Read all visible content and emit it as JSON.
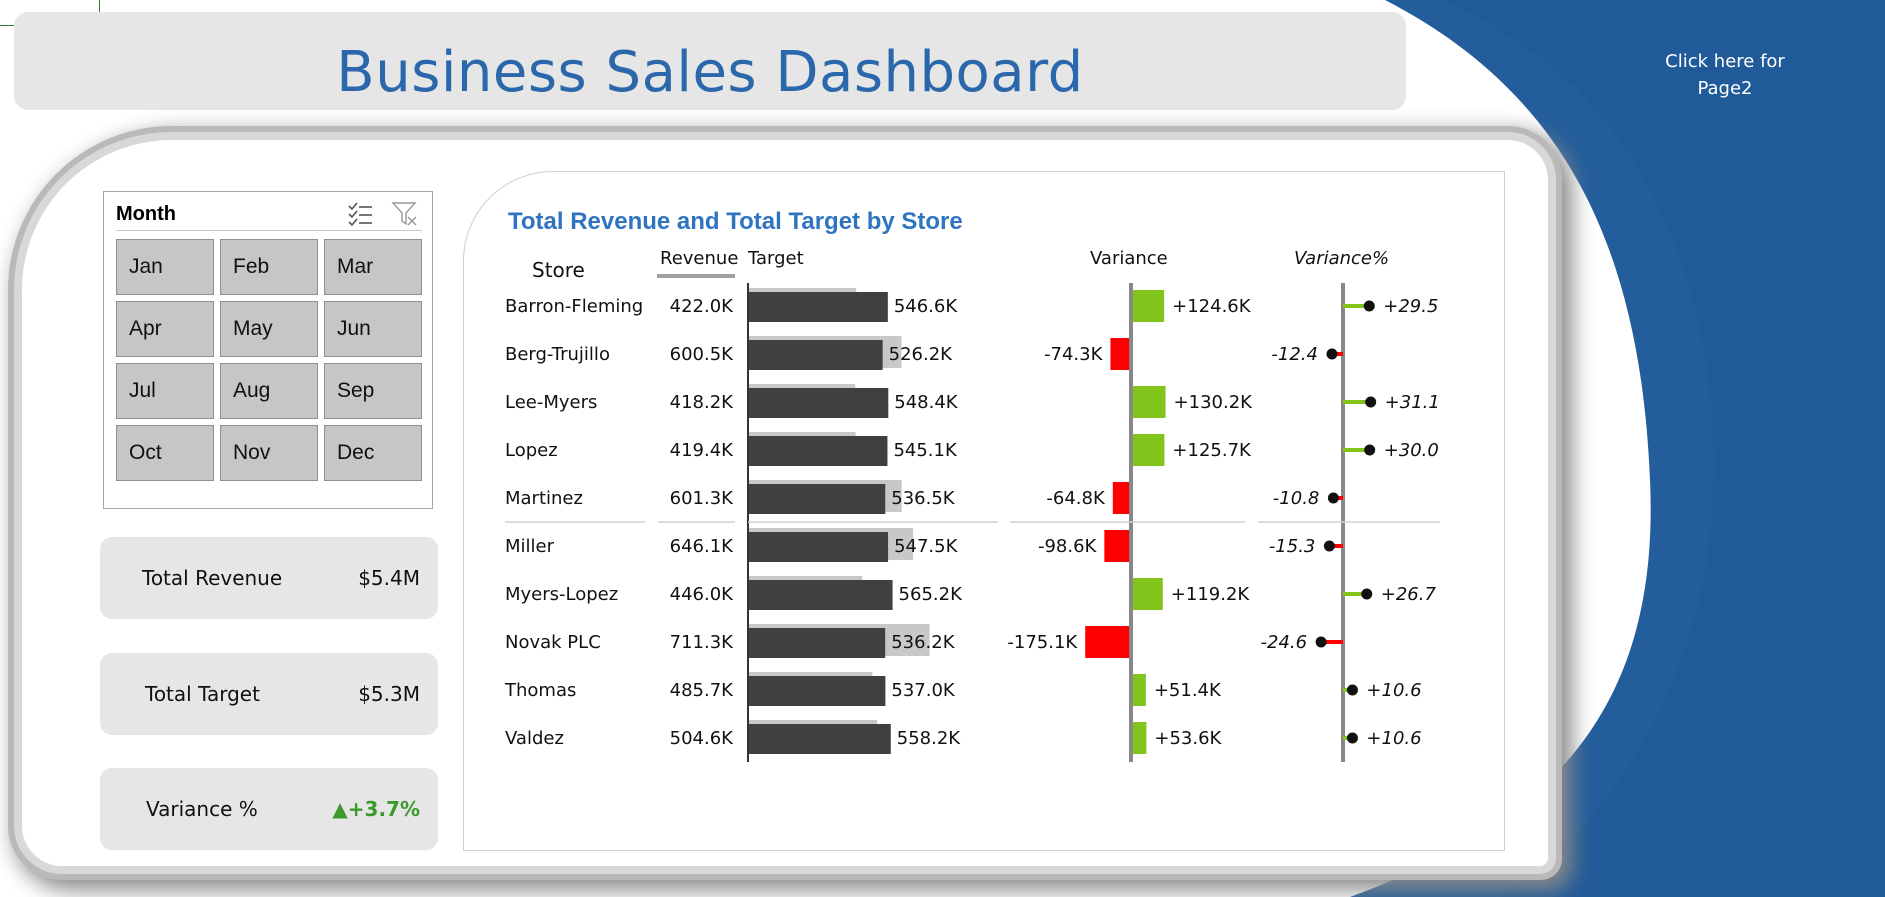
{
  "dashboard": {
    "title": "Business Sales Dashboard",
    "page2_link_line1": "Click here for",
    "page2_link_line2": "Page2"
  },
  "slicer": {
    "title": "Month",
    "months": [
      "Jan",
      "Feb",
      "Mar",
      "Apr",
      "May",
      "Jun",
      "Jul",
      "Aug",
      "Sep",
      "Oct",
      "Nov",
      "Dec"
    ]
  },
  "kpis": {
    "total_revenue_label": "Total Revenue",
    "total_revenue_value": "$5.4M",
    "total_target_label": "Total Target",
    "total_target_value": "$5.3M",
    "variance_label": "Variance %",
    "variance_value": "▲+3.7%"
  },
  "colors": {
    "brand_blue": "#2a67ab",
    "positive": "#80c41c",
    "negative": "#ff0000",
    "bar_dark": "#404040",
    "bar_light": "#c8c8c8"
  },
  "chart_data": {
    "type": "table",
    "title": "Total Revenue and Total Target by Store",
    "columns": [
      "Store",
      "Revenue",
      "Target",
      "Variance",
      "Variance%"
    ],
    "rows": [
      {
        "store": "Barron-Fleming",
        "revenue": "422.0K",
        "target": "546.6K",
        "variance": "+124.6K",
        "variance_pct": "+29.5",
        "revenue_k": 422.0,
        "target_k": 546.6,
        "variance_k": 124.6,
        "pct": 29.5
      },
      {
        "store": "Berg-Trujillo",
        "revenue": "600.5K",
        "target": "526.2K",
        "variance": "-74.3K",
        "variance_pct": "-12.4",
        "revenue_k": 600.5,
        "target_k": 526.2,
        "variance_k": -74.3,
        "pct": -12.4
      },
      {
        "store": "Lee-Myers",
        "revenue": "418.2K",
        "target": "548.4K",
        "variance": "+130.2K",
        "variance_pct": "+31.1",
        "revenue_k": 418.2,
        "target_k": 548.4,
        "variance_k": 130.2,
        "pct": 31.1
      },
      {
        "store": "Lopez",
        "revenue": "419.4K",
        "target": "545.1K",
        "variance": "+125.7K",
        "variance_pct": "+30.0",
        "revenue_k": 419.4,
        "target_k": 545.1,
        "variance_k": 125.7,
        "pct": 30.0
      },
      {
        "store": "Martinez",
        "revenue": "601.3K",
        "target": "536.5K",
        "variance": "-64.8K",
        "variance_pct": "-10.8",
        "revenue_k": 601.3,
        "target_k": 536.5,
        "variance_k": -64.8,
        "pct": -10.8
      },
      {
        "store": "Miller",
        "revenue": "646.1K",
        "target": "547.5K",
        "variance": "-98.6K",
        "variance_pct": "-15.3",
        "revenue_k": 646.1,
        "target_k": 547.5,
        "variance_k": -98.6,
        "pct": -15.3
      },
      {
        "store": "Myers-Lopez",
        "revenue": "446.0K",
        "target": "565.2K",
        "variance": "+119.2K",
        "variance_pct": "+26.7",
        "revenue_k": 446.0,
        "target_k": 565.2,
        "variance_k": 119.2,
        "pct": 26.7
      },
      {
        "store": "Novak PLC",
        "revenue": "711.3K",
        "target": "536.2K",
        "variance": "-175.1K",
        "variance_pct": "-24.6",
        "revenue_k": 711.3,
        "target_k": 536.2,
        "variance_k": -175.1,
        "pct": -24.6
      },
      {
        "store": "Thomas",
        "revenue": "485.7K",
        "target": "537.0K",
        "variance": "+51.4K",
        "variance_pct": "+10.6",
        "revenue_k": 485.7,
        "target_k": 537.0,
        "variance_k": 51.4,
        "pct": 10.6
      },
      {
        "store": "Valdez",
        "revenue": "504.6K",
        "target": "558.2K",
        "variance": "+53.6K",
        "variance_pct": "+10.6",
        "revenue_k": 504.6,
        "target_k": 558.2,
        "variance_k": 53.6,
        "pct": 10.6
      }
    ]
  }
}
